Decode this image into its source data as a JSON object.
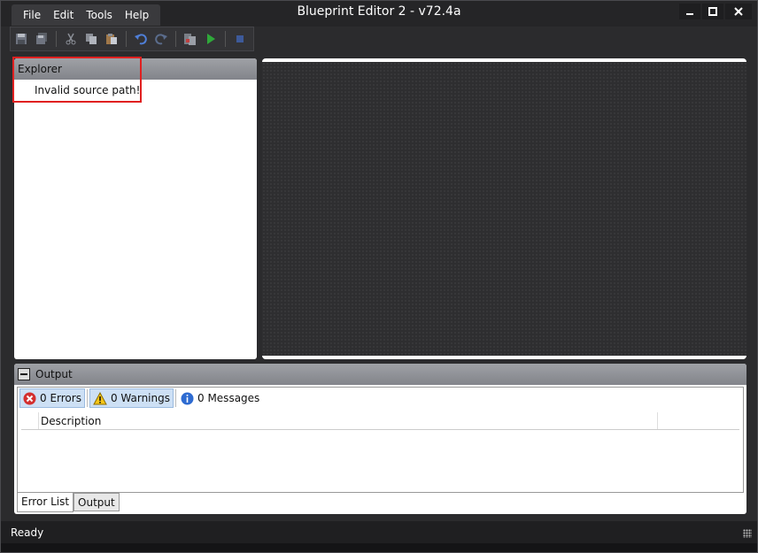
{
  "window": {
    "title": "Blueprint Editor 2 - v72.4a"
  },
  "menu": {
    "items": [
      "File",
      "Edit",
      "Tools",
      "Help"
    ]
  },
  "toolbar": {
    "icons": [
      "save-icon",
      "save-all-icon",
      "cut-icon",
      "copy-icon",
      "paste-icon",
      "undo-icon",
      "redo-icon",
      "build-icon",
      "play-icon",
      "stop-icon"
    ]
  },
  "explorer": {
    "title": "Explorer",
    "message": "Invalid source path!"
  },
  "output": {
    "title": "Output",
    "filters": {
      "errors": "0 Errors",
      "warnings": "0 Warnings",
      "messages": "0 Messages"
    },
    "columns": {
      "description": "Description"
    },
    "tabs": [
      "Error List",
      "Output"
    ]
  },
  "status": {
    "text": "Ready"
  },
  "colors": {
    "accent_error": "#d32f2f",
    "accent_warning": "#f5c518",
    "accent_info": "#2e6bd1",
    "highlight": "#e02020"
  }
}
